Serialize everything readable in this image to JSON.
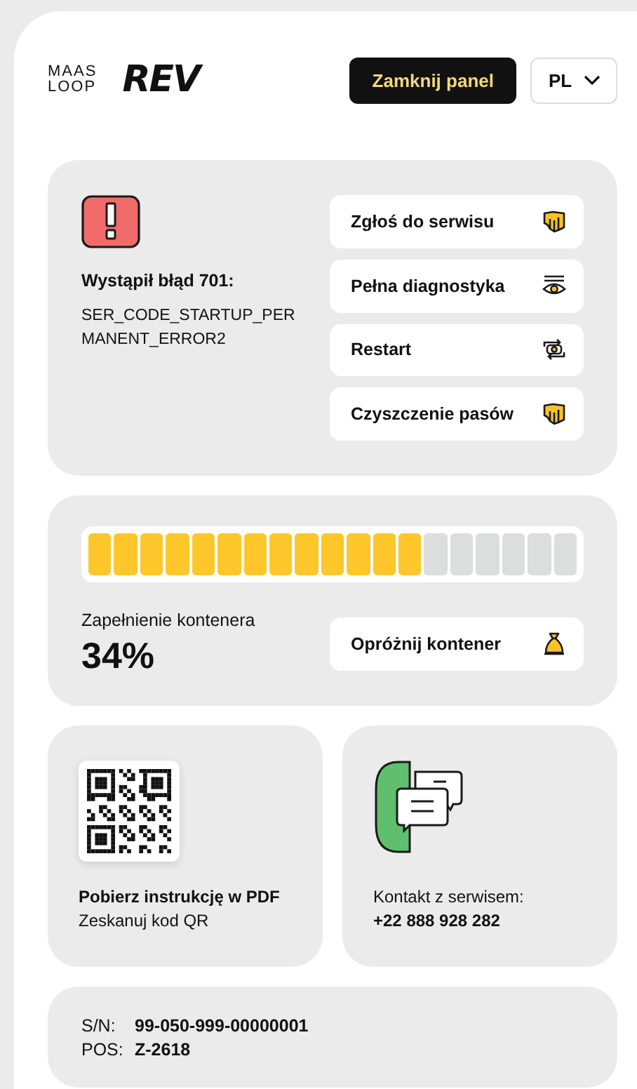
{
  "header": {
    "logos": [
      {
        "kind": "maas",
        "lines": [
          "MAAS",
          "LOOP"
        ]
      },
      {
        "kind": "rev",
        "lines": [
          "REV"
        ]
      }
    ],
    "close_button": "Zamknij panel",
    "language": {
      "value": "PL"
    }
  },
  "error": {
    "title": "Wystąpił błąd 701:",
    "code": "SER_CODE_STARTUP_PERMANENT_ERROR2",
    "actions": [
      {
        "label": "Zgłoś do serwisu",
        "kind": "hand"
      },
      {
        "label": "Pełna diagnostyka",
        "kind": "eye"
      },
      {
        "label": "Restart",
        "kind": "restart"
      },
      {
        "label": "Czyszczenie pasów",
        "kind": "hand"
      }
    ]
  },
  "container": {
    "level": 0.684,
    "label": "Zapełnienie kontenera",
    "percent": "34%",
    "action": {
      "label": "Opróżnij kontener",
      "kind": "bag"
    }
  },
  "manual": {
    "title": "Pobierz instrukcję w PDF",
    "subtitle": "Zeskanuj kod QR"
  },
  "contact": {
    "label": "Kontakt z serwisem:",
    "phone": "+22 888 928 282"
  },
  "device": [
    {
      "label": "S/N:",
      "value": "99-050-999-00000001"
    },
    {
      "label": "POS:",
      "value": "Z-2618"
    }
  ]
}
